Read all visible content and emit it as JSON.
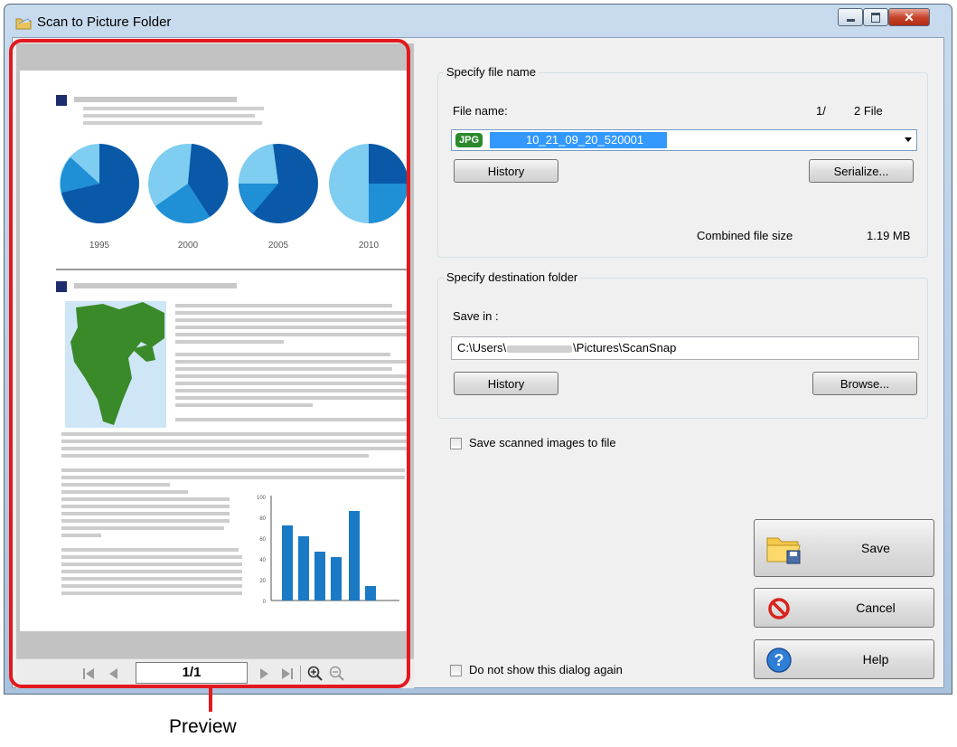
{
  "window": {
    "title": "Scan to Picture Folder"
  },
  "preview": {
    "page_indicator": "1/1",
    "callout": "Preview",
    "doc_chart_years": [
      "1995",
      "2000",
      "2005",
      "2010"
    ],
    "bar_axis_ticks": [
      "100",
      "80",
      "60",
      "40",
      "20",
      "0"
    ]
  },
  "file_name_group": {
    "title": "Specify file name",
    "file_name_label": "File name:",
    "file_counter": "1/",
    "file_total": "2 File",
    "file_badge": "JPG",
    "file_value": "10_21_09_20_520001",
    "history_button": "History",
    "serialize_button": "Serialize...",
    "combined_label": "Combined file size",
    "combined_value": "1.19 MB"
  },
  "destination_group": {
    "title": "Specify destination folder",
    "save_in_label": "Save in :",
    "path_prefix": "C:\\Users\\",
    "path_suffix": "\\Pictures\\ScanSnap",
    "history_button": "History",
    "browse_button": "Browse..."
  },
  "save_scanned": {
    "label": "Save scanned images to file",
    "checked": false
  },
  "dont_show": {
    "label": "Do not show this dialog again",
    "checked": false
  },
  "buttons": {
    "save": "Save",
    "cancel": "Cancel",
    "help": "Help"
  },
  "colors": {
    "accent_red": "#e2191e",
    "jpg_badge": "#2c8a2c",
    "selection": "#3399ff",
    "pie_dark": "#0a58a8",
    "pie_mid": "#1f8fd6",
    "pie_light": "#7fcdf0",
    "bar": "#1a7ac6"
  }
}
